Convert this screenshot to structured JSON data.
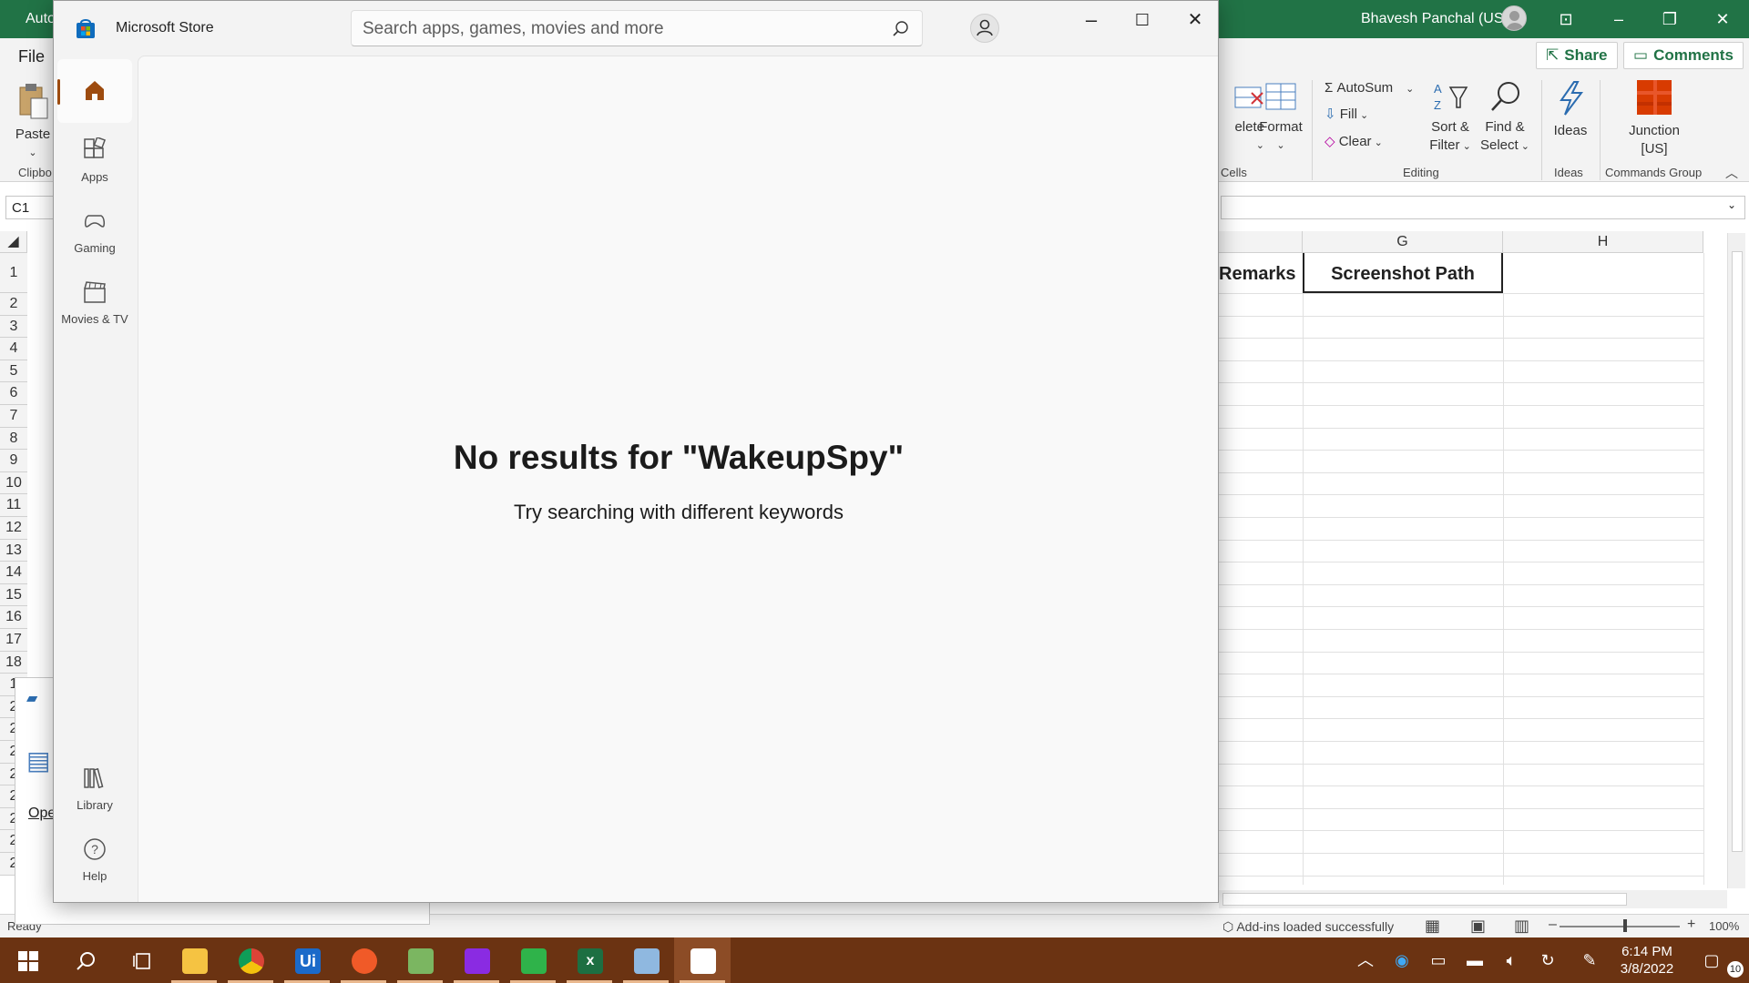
{
  "excel": {
    "title_left": "Auto",
    "user_name": "Bhavesh Panchal (US)",
    "file_tab": "File",
    "share_label": "Share",
    "comments_label": "Comments",
    "ribbon": {
      "paste": "Paste",
      "clipboard_group": "Clipbo",
      "delete": "elete",
      "format": "Format",
      "cells_group": "Cells",
      "autosum": "AutoSum",
      "fill": "Fill",
      "clear": "Clear",
      "sort_filter_1": "Sort &",
      "sort_filter_2": "Filter",
      "find_select_1": "Find &",
      "find_select_2": "Select",
      "editing_group": "Editing",
      "ideas": "Ideas",
      "ideas_group": "Ideas",
      "junction_1": "Junction",
      "junction_2": "[US]",
      "commands_group": "Commands Group"
    },
    "name_box": "C1",
    "columns": [
      "G",
      "H"
    ],
    "header_cells": [
      "Remarks",
      "Screenshot Path"
    ],
    "row_numbers": [
      "1",
      "2",
      "3",
      "4",
      "5",
      "6",
      "7",
      "8",
      "9",
      "10",
      "11",
      "12",
      "13",
      "14",
      "15",
      "16",
      "17",
      "18",
      "1",
      "2",
      "2",
      "2",
      "2",
      "2",
      "2",
      "2",
      "2"
    ],
    "status_ready": "Ready",
    "status_addins": "Add-ins loaded successfully",
    "zoom": "100%",
    "dialog_link": "Ope"
  },
  "store": {
    "title": "Microsoft Store",
    "search_placeholder": "Search apps, games, movies and more",
    "search_value": "",
    "nav": [
      {
        "label": "",
        "icon": "home-icon"
      },
      {
        "label": "Apps",
        "icon": "apps-icon"
      },
      {
        "label": "Gaming",
        "icon": "gaming-icon"
      },
      {
        "label": "Movies & TV",
        "icon": "movies-tv-icon"
      },
      {
        "label": "Library",
        "icon": "library-icon"
      },
      {
        "label": "Help",
        "icon": "help-icon"
      }
    ],
    "heading": "No results for \"WakeupSpy\"",
    "subheading": "Try searching with different keywords",
    "accent_color": "#9d4b0f"
  },
  "taskbar": {
    "time": "6:14 PM",
    "date": "3/8/2022",
    "notification_count": "10",
    "apps": [
      "start-icon",
      "search-icon",
      "task-view-icon",
      "file-explorer-icon",
      "chrome-icon",
      "uipath-icon",
      "orange-app-icon",
      "notepad-app-icon",
      "podcast-app-icon",
      "media-app-icon",
      "excel-icon",
      "rdp-app-icon",
      "store-icon"
    ]
  }
}
